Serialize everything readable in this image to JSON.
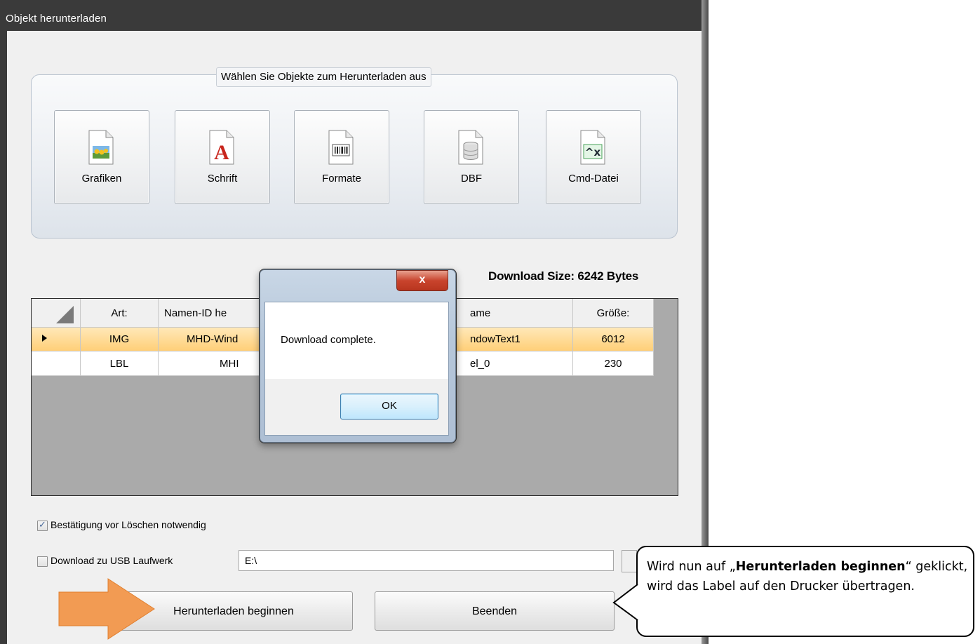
{
  "window": {
    "title": "Objekt herunterladen"
  },
  "group": {
    "title": "Wählen Sie Objekte zum Herunterladen aus",
    "buttons": [
      {
        "label": "Grafiken",
        "icon": "image-file-icon"
      },
      {
        "label": "Schrift",
        "icon": "font-file-icon"
      },
      {
        "label": "Formate",
        "icon": "barcode-file-icon"
      },
      {
        "label": "DBF",
        "icon": "database-file-icon"
      },
      {
        "label": "Cmd-Datei",
        "icon": "command-file-icon"
      }
    ]
  },
  "download_size": "Download Size: 6242 Bytes",
  "table": {
    "columns": [
      "Art:",
      "Namen-ID he",
      "ame",
      "Größe:"
    ],
    "rows": [
      {
        "type": "IMG",
        "name_id": "MHD-Wind",
        "name": "ndowText1",
        "size": "6012",
        "selected": true
      },
      {
        "type": "LBL",
        "name_id": "MHI",
        "name": "el_0",
        "size": "230",
        "selected": false
      }
    ]
  },
  "options": {
    "confirm_delete": {
      "label": "Bestätigung vor Löschen notwendig",
      "checked": true
    },
    "usb_download": {
      "label": "Download zu USB Laufwerk",
      "checked": false,
      "path": "E:\\"
    }
  },
  "buttons": {
    "start": "Herunterladen beginnen",
    "exit": "Beenden"
  },
  "dialog": {
    "close": "x",
    "message": "Download complete.",
    "ok": "OK"
  },
  "callout": {
    "pre": "Wird nun auf „",
    "bold": "Herunterladen beginnen",
    "post": "“ geklickt, wird das Label auf den Drucker übertragen."
  },
  "colors": {
    "arrow": "#f29b53",
    "selected_row": "#ffcf78",
    "close_button": "#c9442d"
  }
}
